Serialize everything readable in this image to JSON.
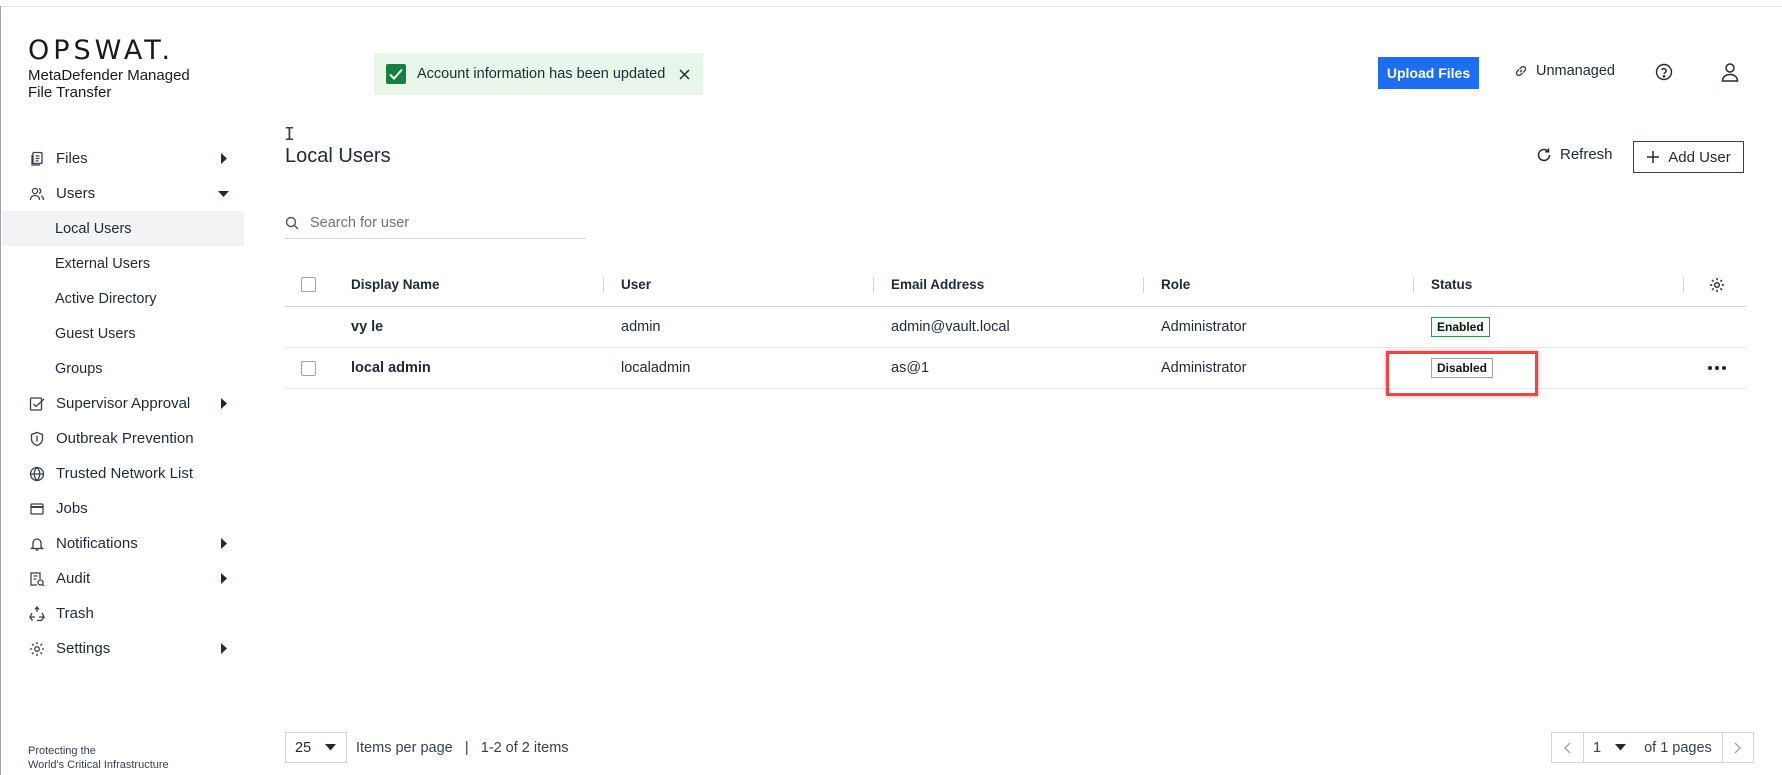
{
  "brand": {
    "logo": "OPSWAT.",
    "product": "MetaDefender Managed File Transfer",
    "tagline_line1": "Protecting the",
    "tagline_line2": "World's Critical Infrastructure"
  },
  "sidebar": {
    "items": [
      {
        "label": "Files",
        "icon": "files-icon",
        "arrow": "right"
      },
      {
        "label": "Users",
        "icon": "users-icon",
        "arrow": "down"
      },
      {
        "label": "Supervisor Approval",
        "icon": "approval-icon",
        "arrow": "right"
      },
      {
        "label": "Outbreak Prevention",
        "icon": "shield-icon",
        "arrow": ""
      },
      {
        "label": "Trusted Network List",
        "icon": "globe-icon",
        "arrow": ""
      },
      {
        "label": "Jobs",
        "icon": "jobs-icon",
        "arrow": ""
      },
      {
        "label": "Notifications",
        "icon": "bell-icon",
        "arrow": "right"
      },
      {
        "label": "Audit",
        "icon": "audit-icon",
        "arrow": "right"
      },
      {
        "label": "Trash",
        "icon": "recycle-icon",
        "arrow": ""
      },
      {
        "label": "Settings",
        "icon": "gear-icon",
        "arrow": "right"
      }
    ],
    "users_sub": [
      "Local Users",
      "External Users",
      "Active Directory",
      "Guest Users",
      "Groups"
    ],
    "active_sub": "Local Users"
  },
  "toast": {
    "message": "Account information has been updated"
  },
  "header": {
    "upload_label": "Upload Files",
    "unmanaged_label": "Unmanaged"
  },
  "page": {
    "title": "Local Users",
    "refresh_label": "Refresh",
    "add_user_label": "Add User",
    "search_placeholder": "Search for user"
  },
  "table": {
    "columns": [
      "Display Name",
      "User",
      "Email Address",
      "Role",
      "Status"
    ],
    "rows": [
      {
        "display_name": "vy le",
        "user": "admin",
        "email": "admin@vault.local",
        "role": "Administrator",
        "status": "Enabled",
        "status_color": "#16a34a"
      },
      {
        "display_name": "local admin",
        "user": "localadmin",
        "email": "as@1",
        "role": "Administrator",
        "status": "Disabled",
        "status_color": "#9ca3af"
      }
    ]
  },
  "pagination": {
    "per_page": "25",
    "per_page_label": "Items per page",
    "range_label": "1-2 of 2 items",
    "page": "1",
    "of_pages": "of 1 pages"
  },
  "colors": {
    "primary": "#1d6ef2",
    "toast_bg": "#e8f5e9",
    "success": "#15803d",
    "highlight": "#ef4444"
  }
}
